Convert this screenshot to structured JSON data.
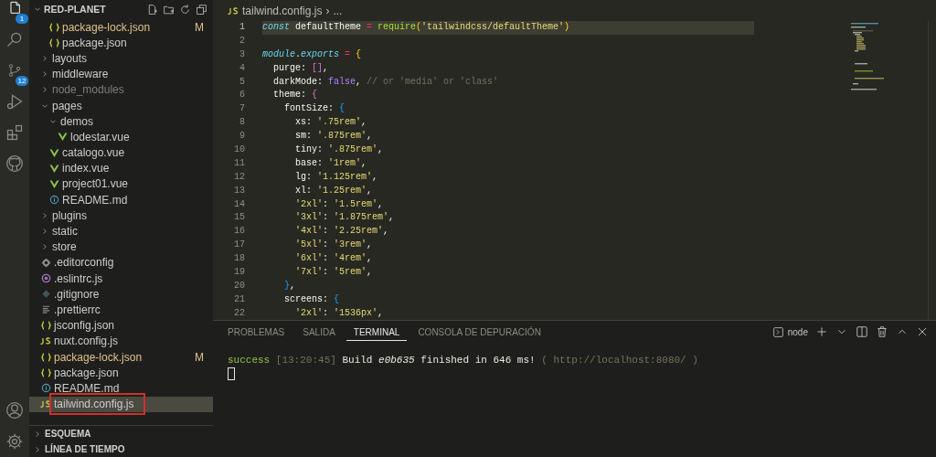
{
  "activity_bar": {
    "items": [
      {
        "kind": "files",
        "badge": "1",
        "selected": true
      },
      {
        "kind": "search",
        "selected": false
      },
      {
        "kind": "source-control",
        "badge": "12",
        "selected": false
      },
      {
        "kind": "run",
        "selected": false
      },
      {
        "kind": "extensions",
        "selected": false
      },
      {
        "kind": "github",
        "selected": false
      }
    ],
    "bottom_items": [
      {
        "kind": "account"
      },
      {
        "kind": "settings"
      }
    ]
  },
  "explorer": {
    "title": "RED-PLANET",
    "tree": [
      {
        "children": [
          {
            "name": "package-lock.json",
            "kind": "json",
            "modified": "M",
            "selected": false
          },
          {
            "name": "package.json",
            "kind": "json",
            "selected": false
          }
        ]
      },
      {
        "name": "layouts",
        "kind": "folder",
        "expanded": false,
        "selected": false
      },
      {
        "name": "middleware",
        "kind": "folder",
        "expanded": false,
        "selected": false
      },
      {
        "name": "node_modules",
        "kind": "folder",
        "expanded": false,
        "ignored": true,
        "selected": false
      },
      {
        "name": "pages",
        "kind": "folder",
        "expanded": true,
        "selected": false,
        "children": [
          {
            "name": "demos",
            "kind": "folder",
            "expanded": true,
            "selected": false,
            "children": [
              {
                "name": "lodestar.vue",
                "kind": "vue",
                "selected": false
              }
            ]
          },
          {
            "name": "catalogo.vue",
            "kind": "vue",
            "selected": false
          },
          {
            "name": "index.vue",
            "kind": "vue",
            "selected": false
          },
          {
            "name": "project01.vue",
            "kind": "vue",
            "selected": false
          },
          {
            "name": "README.md",
            "kind": "info",
            "selected": false
          }
        ]
      },
      {
        "name": "plugins",
        "kind": "folder",
        "expanded": false,
        "selected": false
      },
      {
        "name": "static",
        "kind": "folder",
        "expanded": false,
        "selected": false
      },
      {
        "name": "store",
        "kind": "folder",
        "expanded": false,
        "selected": false
      },
      {
        "name": ".editorconfig",
        "kind": "gear",
        "selected": false
      },
      {
        "name": ".eslintrc.js",
        "kind": "eslint",
        "selected": false
      },
      {
        "name": ".gitignore",
        "kind": "git",
        "selected": false
      },
      {
        "name": ".prettierrc",
        "kind": "lines",
        "selected": false
      },
      {
        "name": "jsconfig.json",
        "kind": "json",
        "selected": false
      },
      {
        "name": "nuxt.config.js",
        "kind": "js",
        "selected": false
      },
      {
        "name": "package-lock.json",
        "kind": "json",
        "modified": "M",
        "selected": false
      },
      {
        "name": "package.json",
        "kind": "json",
        "selected": false
      },
      {
        "name": "README.md",
        "kind": "info",
        "selected": false
      },
      {
        "name": "tailwind.config.js",
        "kind": "js",
        "selected": true,
        "outlined": true
      }
    ],
    "sections": [
      {
        "title": "ESQUEMA",
        "expanded": false
      },
      {
        "title": "LÍNEA DE TIEMPO",
        "expanded": false
      }
    ]
  },
  "editor": {
    "breadcrumb": {
      "file": "tailwind.config.js",
      "separator": "›",
      "rest": "..."
    },
    "lines": [
      {
        "number": "1",
        "current": true,
        "tokens": [
          {
            "text": "const",
            "kind": "keyword"
          },
          {
            "text": " defaultTheme ",
            "kind": "plain"
          },
          {
            "text": "=",
            "kind": "operator"
          },
          {
            "text": " require",
            "kind": "function"
          },
          {
            "text": "(",
            "kind": "bracket1"
          },
          {
            "text": "'tailwindcss/defaultTheme'",
            "kind": "string"
          },
          {
            "text": ")",
            "kind": "bracket1"
          }
        ]
      },
      {
        "number": "2",
        "current": false
      },
      {
        "number": "3",
        "current": false,
        "tokens": [
          {
            "text": "module",
            "kind": "keyword"
          },
          {
            "text": ".",
            "kind": "plain"
          },
          {
            "text": "exports",
            "kind": "keyword"
          },
          {
            "text": " =",
            "kind": "operator"
          },
          {
            "text": " {",
            "kind": "bracket1"
          }
        ]
      },
      {
        "number": "4",
        "current": false,
        "tokens": [
          {
            "text": "  purge: ",
            "kind": "plain"
          },
          {
            "text": "[]",
            "kind": "bracket2"
          },
          {
            "text": ",",
            "kind": "plain"
          }
        ]
      },
      {
        "number": "5",
        "current": false,
        "tokens": [
          {
            "text": "  darkMode: ",
            "kind": "plain"
          },
          {
            "text": "false",
            "kind": "boolean"
          },
          {
            "text": ", ",
            "kind": "plain"
          },
          {
            "text": "// or 'media' or 'class'",
            "kind": "comment"
          }
        ]
      },
      {
        "number": "6",
        "current": false,
        "tokens": [
          {
            "text": "  theme: ",
            "kind": "plain"
          },
          {
            "text": "{",
            "kind": "bracket2"
          }
        ]
      },
      {
        "number": "7",
        "current": false,
        "tokens": [
          {
            "text": "    fontSize: ",
            "kind": "plain"
          },
          {
            "text": "{",
            "kind": "bracket3"
          }
        ]
      },
      {
        "number": "8",
        "current": false,
        "tokens": [
          {
            "text": "      xs: ",
            "kind": "plain"
          },
          {
            "text": "'.75rem'",
            "kind": "string"
          },
          {
            "text": ",",
            "kind": "plain"
          }
        ]
      },
      {
        "number": "9",
        "current": false,
        "tokens": [
          {
            "text": "      sm: ",
            "kind": "plain"
          },
          {
            "text": "'.875rem'",
            "kind": "string"
          },
          {
            "text": ",",
            "kind": "plain"
          }
        ]
      },
      {
        "number": "10",
        "current": false,
        "tokens": [
          {
            "text": "      tiny: ",
            "kind": "plain"
          },
          {
            "text": "'.875rem'",
            "kind": "string"
          },
          {
            "text": ",",
            "kind": "plain"
          }
        ]
      },
      {
        "number": "11",
        "current": false,
        "tokens": [
          {
            "text": "      base: ",
            "kind": "plain"
          },
          {
            "text": "'1rem'",
            "kind": "string"
          },
          {
            "text": ",",
            "kind": "plain"
          }
        ]
      },
      {
        "number": "12",
        "current": false,
        "tokens": [
          {
            "text": "      lg: ",
            "kind": "plain"
          },
          {
            "text": "'1.125rem'",
            "kind": "string"
          },
          {
            "text": ",",
            "kind": "plain"
          }
        ]
      },
      {
        "number": "13",
        "current": false,
        "tokens": [
          {
            "text": "      xl: ",
            "kind": "plain"
          },
          {
            "text": "'1.25rem'",
            "kind": "string"
          },
          {
            "text": ",",
            "kind": "plain"
          }
        ]
      },
      {
        "number": "14",
        "current": false,
        "tokens": [
          {
            "text": "      '2xl'",
            "kind": "string"
          },
          {
            "text": ": ",
            "kind": "plain"
          },
          {
            "text": "'1.5rem'",
            "kind": "string"
          },
          {
            "text": ",",
            "kind": "plain"
          }
        ]
      },
      {
        "number": "15",
        "current": false,
        "tokens": [
          {
            "text": "      '3xl'",
            "kind": "string"
          },
          {
            "text": ": ",
            "kind": "plain"
          },
          {
            "text": "'1.875rem'",
            "kind": "string"
          },
          {
            "text": ",",
            "kind": "plain"
          }
        ]
      },
      {
        "number": "16",
        "current": false,
        "tokens": [
          {
            "text": "      '4xl'",
            "kind": "string"
          },
          {
            "text": ": ",
            "kind": "plain"
          },
          {
            "text": "'2.25rem'",
            "kind": "string"
          },
          {
            "text": ",",
            "kind": "plain"
          }
        ]
      },
      {
        "number": "17",
        "current": false,
        "tokens": [
          {
            "text": "      '5xl'",
            "kind": "string"
          },
          {
            "text": ": ",
            "kind": "plain"
          },
          {
            "text": "'3rem'",
            "kind": "string"
          },
          {
            "text": ",",
            "kind": "plain"
          }
        ]
      },
      {
        "number": "18",
        "current": false,
        "tokens": [
          {
            "text": "      '6xl'",
            "kind": "string"
          },
          {
            "text": ": ",
            "kind": "plain"
          },
          {
            "text": "'4rem'",
            "kind": "string"
          },
          {
            "text": ",",
            "kind": "plain"
          }
        ]
      },
      {
        "number": "19",
        "current": false,
        "tokens": [
          {
            "text": "      '7xl'",
            "kind": "string"
          },
          {
            "text": ": ",
            "kind": "plain"
          },
          {
            "text": "'5rem'",
            "kind": "string"
          },
          {
            "text": ",",
            "kind": "plain"
          }
        ]
      },
      {
        "number": "20",
        "current": false,
        "tokens": [
          {
            "text": "    }",
            "kind": "bracket3"
          },
          {
            "text": ",",
            "kind": "plain"
          }
        ]
      },
      {
        "number": "21",
        "current": false,
        "tokens": [
          {
            "text": "    screens: ",
            "kind": "plain"
          },
          {
            "text": "{",
            "kind": "bracket3"
          }
        ]
      },
      {
        "number": "22",
        "current": false,
        "tokens": [
          {
            "text": "      '2xl'",
            "kind": "string"
          },
          {
            "text": ": ",
            "kind": "plain"
          },
          {
            "text": "'1536px'",
            "kind": "string"
          },
          {
            "text": ",",
            "kind": "plain"
          }
        ]
      }
    ]
  },
  "panel": {
    "tabs": [
      {
        "label": "PROBLEMAS",
        "selected": false
      },
      {
        "label": "SALIDA",
        "selected": false
      },
      {
        "label": "TERMINAL",
        "selected": true
      },
      {
        "label": "CONSOLA DE DEPURACIÓN",
        "selected": false
      }
    ],
    "terminal_name": "node",
    "terminal_lines": [
      [
        {
          "text": "success",
          "kind": "success"
        },
        {
          "text": " [13:20:45] ",
          "kind": "dim"
        },
        {
          "text": "Build ",
          "kind": "plain"
        },
        {
          "text": "e0b635",
          "kind": "italic"
        },
        {
          "text": " finished in 646 ms! ",
          "kind": "plain"
        },
        {
          "text": "( http://localhost:8080/ )",
          "kind": "dim"
        }
      ]
    ]
  }
}
